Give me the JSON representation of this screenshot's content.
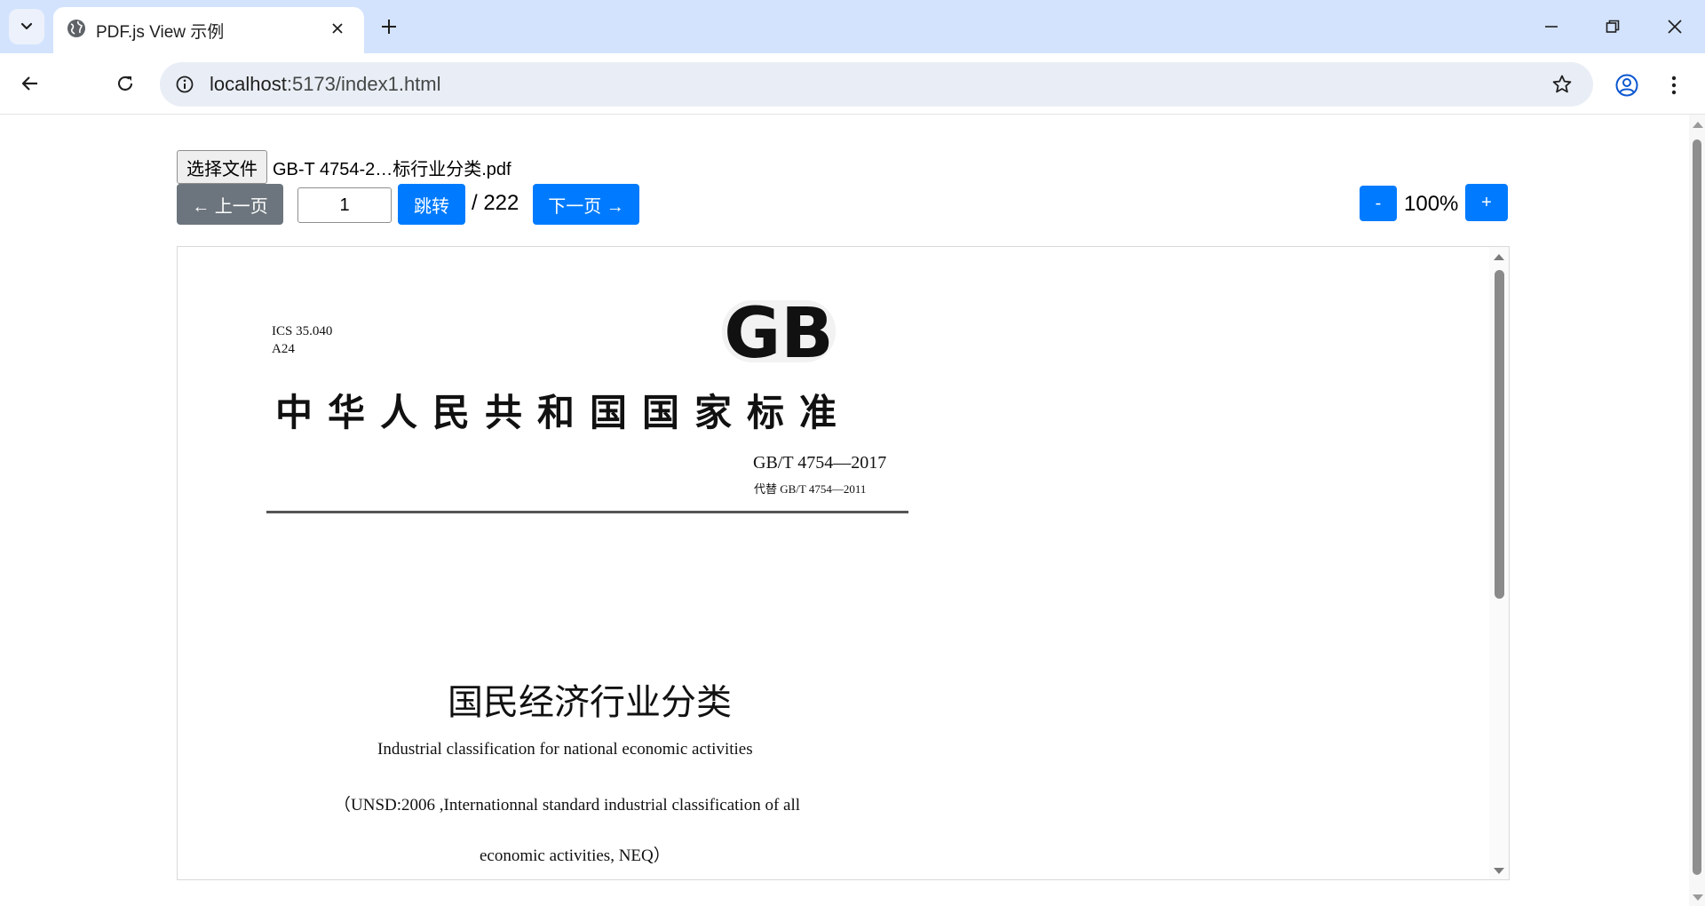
{
  "browser": {
    "tab": {
      "title": "PDF.js View 示例"
    },
    "address": {
      "host": "localhost",
      "path": ":5173/index1.html"
    },
    "icons": {
      "tab_search": "chevron-down-icon",
      "favicon": "globe-icon",
      "tab_close": "close-icon",
      "new_tab": "plus-icon",
      "minimize": "minimize-icon",
      "restore": "restore-icon",
      "close_window": "close-icon",
      "back": "arrow-left-icon",
      "reload": "reload-icon",
      "site_info": "info-icon",
      "bookmark": "star-icon",
      "profile": "profile-icon",
      "menu": "more-vert-icon"
    }
  },
  "viewer": {
    "file_button": "选择文件",
    "file_name": "GB-T 4754-2…标行业分类.pdf",
    "prev_button": "← 上一页",
    "page_input_value": "1",
    "go_button": "跳转",
    "page_total": "/ 222",
    "next_button": "下一页 →",
    "zoom_out_button": "-",
    "zoom_level": "100%",
    "zoom_in_button": "+",
    "colors": {
      "primary": "#007bff",
      "secondary": "#6c757d"
    }
  },
  "document": {
    "ics_line1": "ICS 35.040",
    "ics_line2": "A24",
    "logo_text": "GB",
    "standard_title": "中华人民共和国国家标准",
    "standard_code": "GB/T 4754—2017",
    "replaces": "代替 GB/T 4754—2011",
    "title_cn": "国民经济行业分类",
    "title_en": "Industrial classification for national economic activities",
    "reference_line1": "（UNSD:2006 ,Internationnal standard industrial classification of all",
    "reference_line2": "economic activities, NEQ）"
  }
}
